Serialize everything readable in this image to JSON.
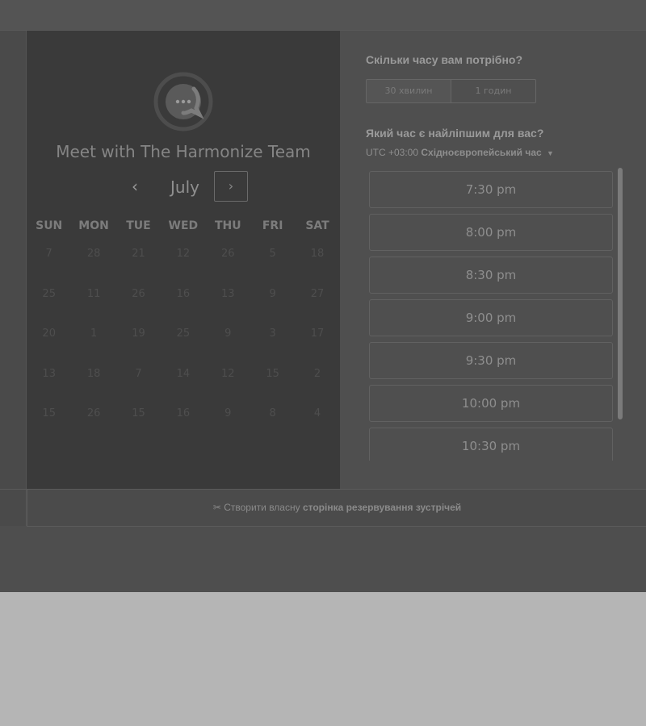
{
  "calendar": {
    "title": "Meet with The Harmonize Team",
    "month": "July",
    "prev_icon": "‹",
    "next_icon": "›",
    "weekdays": [
      "SUN",
      "MON",
      "TUE",
      "WED",
      "THU",
      "FRI",
      "SAT"
    ],
    "weeks": [
      [
        "7",
        "28",
        "21",
        "12",
        "26",
        "5",
        "18"
      ],
      [
        "25",
        "11",
        "26",
        "16",
        "13",
        "9",
        "27"
      ],
      [
        "20",
        "1",
        "19",
        "25",
        "9",
        "3",
        "17"
      ],
      [
        "13",
        "18",
        "7",
        "14",
        "12",
        "15",
        "2"
      ],
      [
        "15",
        "26",
        "15",
        "16",
        "9",
        "8",
        "4"
      ]
    ]
  },
  "booking": {
    "duration_question": "Скільки часу вам потрібно?",
    "durations": [
      "30 хвилин",
      "1 годин"
    ],
    "time_question": "Який час є найліпшим для вас?",
    "timezone_offset": "UTC +03:00",
    "timezone_name": "Східноєвропейський час",
    "timezone_caret": "▼",
    "slots": [
      "7:30 pm",
      "8:00 pm",
      "8:30 pm",
      "9:00 pm",
      "9:30 pm",
      "10:00 pm",
      "10:30 pm"
    ]
  },
  "footer": {
    "icon": "✂",
    "text_regular": "Створити власну",
    "text_bold": "сторінка резервування зустрічей"
  }
}
